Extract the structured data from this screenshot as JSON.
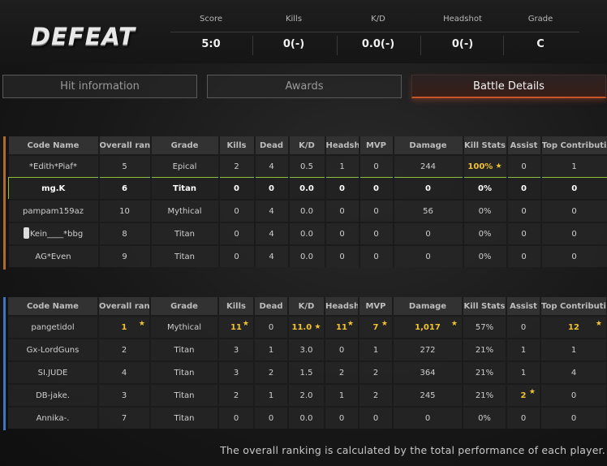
{
  "result": "DEFEAT",
  "stats": [
    {
      "label": "Score",
      "value": "5:0"
    },
    {
      "label": "Kills",
      "value": "0(-)"
    },
    {
      "label": "K/D",
      "value": "0.0(-)"
    },
    {
      "label": "Headshot",
      "value": "0(-)"
    },
    {
      "label": "Grade",
      "value": "C"
    }
  ],
  "tabs": [
    "Hit information",
    "Awards",
    "Battle Details"
  ],
  "active_tab": "Battle Details",
  "columns": [
    "Code Name",
    "Overall rank",
    "Grade",
    "Kills",
    "Dead",
    "K/D",
    "Headshot",
    "MVP",
    "Damage",
    "Kill Stats",
    "Assist",
    "Top Contribution"
  ],
  "team_colors": {
    "team1": "#b06a2c",
    "team2": "#3f74c0",
    "highlight": "#8cbf3a",
    "gold": "#f2c230"
  },
  "team1": [
    {
      "name": "*Edith*Piaf*",
      "rank": "5",
      "grade": "Epical",
      "kills": "2",
      "dead": "4",
      "kd": "0.5",
      "headshot": "1",
      "mvp": "0",
      "damage": "244",
      "killstats": "100%",
      "assist": "0",
      "top": "1"
    },
    {
      "name": "mg.K",
      "rank": "6",
      "grade": "Titan",
      "kills": "0",
      "dead": "0",
      "kd": "0.0",
      "headshot": "0",
      "mvp": "0",
      "damage": "0",
      "killstats": "0%",
      "assist": "0",
      "top": "0"
    },
    {
      "name": "pampam159az",
      "rank": "10",
      "grade": "Mythical",
      "kills": "0",
      "dead": "4",
      "kd": "0.0",
      "headshot": "0",
      "mvp": "0",
      "damage": "56",
      "killstats": "0%",
      "assist": "0",
      "top": "0"
    },
    {
      "name": "Kein____*bbg",
      "rank": "8",
      "grade": "Titan",
      "kills": "0",
      "dead": "4",
      "kd": "0.0",
      "headshot": "0",
      "mvp": "0",
      "damage": "0",
      "killstats": "0%",
      "assist": "0",
      "top": "0"
    },
    {
      "name": "AG*Even",
      "rank": "9",
      "grade": "Titan",
      "kills": "0",
      "dead": "4",
      "kd": "0.0",
      "headshot": "0",
      "mvp": "0",
      "damage": "0",
      "killstats": "0%",
      "assist": "0",
      "top": "0"
    }
  ],
  "team2": [
    {
      "name": "pangetidol",
      "rank": "1",
      "grade": "Mythical",
      "kills": "11",
      "dead": "0",
      "kd": "11.0",
      "headshot": "11",
      "mvp": "7",
      "damage": "1,017",
      "killstats": "57%",
      "assist": "0",
      "top": "12"
    },
    {
      "name": "Gx-LordGuns",
      "rank": "2",
      "grade": "Titan",
      "kills": "3",
      "dead": "1",
      "kd": "3.0",
      "headshot": "0",
      "mvp": "1",
      "damage": "272",
      "killstats": "21%",
      "assist": "1",
      "top": "1"
    },
    {
      "name": "SI.JUDE",
      "rank": "4",
      "grade": "Titan",
      "kills": "3",
      "dead": "2",
      "kd": "1.5",
      "headshot": "2",
      "mvp": "2",
      "damage": "364",
      "killstats": "21%",
      "assist": "1",
      "top": "4"
    },
    {
      "name": "DB-jake.",
      "rank": "3",
      "grade": "Titan",
      "kills": "2",
      "dead": "1",
      "kd": "2.0",
      "headshot": "1",
      "mvp": "2",
      "damage": "245",
      "killstats": "21%",
      "assist": "2",
      "top": "0"
    },
    {
      "name": "Annika-.",
      "rank": "7",
      "grade": "Titan",
      "kills": "0",
      "dead": "0",
      "kd": "0.0",
      "headshot": "0",
      "mvp": "0",
      "damage": "0",
      "killstats": "0%",
      "assist": "0",
      "top": "0"
    }
  ],
  "footer": "The overall ranking is calculated by the total performance of each player."
}
